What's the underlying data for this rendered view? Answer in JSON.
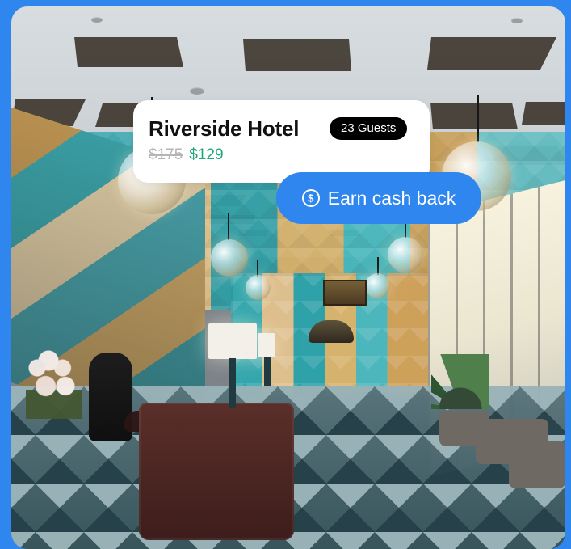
{
  "hotel_card": {
    "title": "Riverside Hotel",
    "guest_badge": "23 Guests",
    "original_price": "$175",
    "discount_price": "$129"
  },
  "cashback": {
    "label": "Earn cash back",
    "icon": "dollar-circle-icon"
  },
  "colors": {
    "background_blue": "#2f86ee",
    "price_green": "#1ea77a",
    "badge_black": "#000000",
    "card_white": "#ffffff"
  },
  "photo": {
    "subject": "hotel-lobby-photo"
  }
}
